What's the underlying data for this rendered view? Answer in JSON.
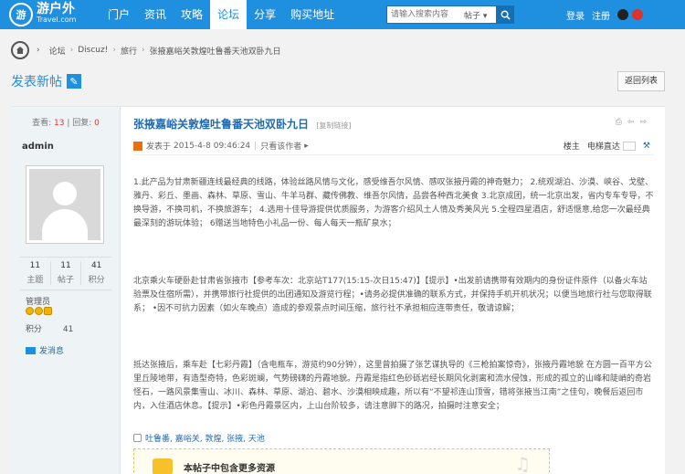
{
  "header": {
    "logo_cn": "游户外",
    "logo_en": "Travel.com",
    "logo_mark": "游",
    "registered": "®",
    "nav": [
      "门户",
      "资讯",
      "攻略",
      "论坛",
      "分享",
      "购买地址"
    ],
    "active_nav": "论坛",
    "search_placeholder": "请输入搜索内容",
    "search_scope": "帖子 ▾",
    "login": "登录",
    "register": "注册"
  },
  "breadcrumb": {
    "home_icon_text": "논",
    "items": [
      "论坛",
      "Discuz!",
      "旅行",
      "张掖嘉峪关敦煌吐鲁番天池双卧九日"
    ],
    "separator": "›"
  },
  "actions": {
    "post_new": "发表新帖",
    "return_list": "返回列表"
  },
  "sidebar": {
    "views_label": "查看:",
    "views": "13",
    "replies_label": "回复:",
    "replies": "0",
    "username": "admin",
    "stats": [
      {
        "value": "11",
        "label": "主题"
      },
      {
        "value": "11",
        "label": "帖子"
      },
      {
        "value": "41",
        "label": "积分"
      }
    ],
    "group": "管理员",
    "credit_label": "积分",
    "credit_value": "41",
    "send_message": "发消息"
  },
  "post": {
    "title": "张掖嘉峪关敦煌吐鲁番天池双卧九日",
    "copy_link": "[复制链接]",
    "posted_prefix": "发表于",
    "posted_time": "2015-4-8 09:46:24",
    "only_author": "只看该作者",
    "floor": "楼主",
    "jump": "电梯直达",
    "para1": "1.此产品为甘肃新疆连线最经典的线路，体验丝路风情与文化，感受维吾尔风情、感叹张掖丹霞的神奇魅力； 2.统观湖泊、沙漠、峡谷、戈壁、雅丹、彩丘、墨画、森林、草原、雪山、牛羊马群、藏传佛教、维吾尔风情，品尝各种西北美食 3.北京成团，统一北京出发，省内专车专导，不换导游，不换司机，不换旅游车； 4.选用十佳导游提供优质服务，为游客介绍风土人情及秀美风光 5.全程四星酒店，舒适惬意,给您一次最经典最深刻的游玩体验； 6赠送当地特色小礼品一份、每人每天一瓶矿泉水；",
    "para2": "北京乘火车硬卧赴甘肃省张掖市【参考车次：北京站T177(15:15-次日15:47)】【提示】•出发前请携带有效期内的身份证件原件（以备火车站验票及住宿所需），并携带旅行社提供的出团通知及游览行程；•请务必提供准确的联系方式，并保持手机开机状况；以便当地旅行社与您取得联系； •因不可抗力因素（如火车晚点）造成的参观景点时间压缩，旅行社不承担相应连带责任，敬请谅解；",
    "para3": "抵达张掖后，乘车赴【七彩丹霞】（含电瓶车，游览约90分钟），这里曾拍摄了张艺谋执导的《三枪拍案惊奇》，张掖丹霞地貌 在方圆一百平方公里丘陵地带，有造型奇特，色彩斑斓，气势磅礴的丹霞地貌。丹霞是指红色砂砾岩经长期风化剥离和流水侵蚀，形成的孤立的山峰和陡峭的奇岩怪石，一路风景集雪山、冰川、森林、草原、湖泊、碧水、沙漠相映成趣，所以有“不望祁连山顶雪，错将张掖当江南”之佳句，晚餐后返回市内，入住酒店休息。【提示】•彩色丹霞景区内，上山台阶较多，请注意脚下的路况，拍摄时注意安全；",
    "tags": "吐鲁番, 嘉峪关, 敦煌, 张掖, 天池",
    "resource": "本帖子中包含更多资源"
  },
  "colors": {
    "brand": "#1f8fe0",
    "link": "#1f6ab3",
    "count_red": "#e33333"
  }
}
